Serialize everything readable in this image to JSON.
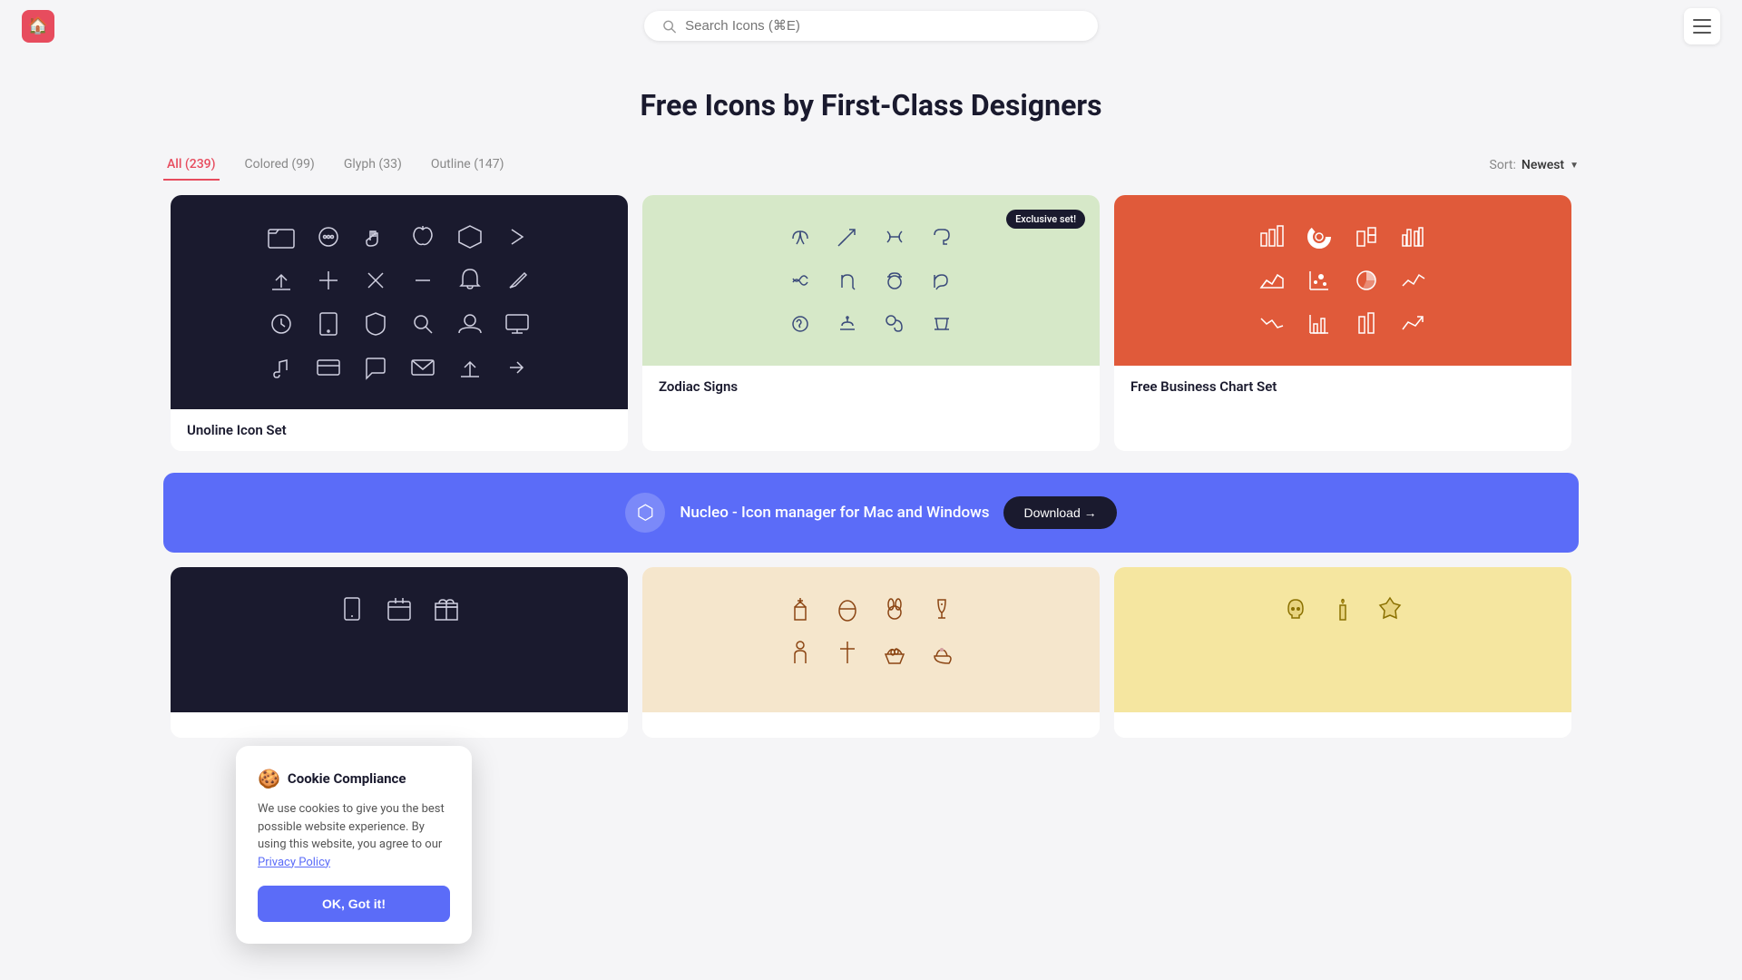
{
  "header": {
    "logo_label": "Nucleo Home",
    "search_placeholder": "Search Icons (⌘E)",
    "menu_label": "Menu"
  },
  "page": {
    "title": "Free Icons by First-Class Designers"
  },
  "filters": {
    "tabs": [
      {
        "id": "all",
        "label": "All (239)",
        "active": true
      },
      {
        "id": "colored",
        "label": "Colored (99)",
        "active": false
      },
      {
        "id": "glyph",
        "label": "Glyph (33)",
        "active": false
      },
      {
        "id": "outline",
        "label": "Outline (147)",
        "active": false
      }
    ],
    "sort_label": "Sort:",
    "sort_value": "Newest"
  },
  "icon_sets": [
    {
      "id": "unoline",
      "label": "Unoline Icon Set",
      "theme": "dark",
      "exclusive": false
    },
    {
      "id": "zodiac",
      "label": "Zodiac Signs",
      "theme": "green",
      "exclusive": true,
      "exclusive_label": "Exclusive set!"
    },
    {
      "id": "business",
      "label": "Free Business Chart Set",
      "theme": "orange",
      "exclusive": false
    }
  ],
  "banner": {
    "text": "Nucleo - Icon manager for Mac and Windows",
    "button_label": "Download →"
  },
  "bottom_sets": [
    {
      "id": "dark-icons",
      "label": "",
      "theme": "dark2"
    },
    {
      "id": "easter",
      "label": "",
      "theme": "peach"
    },
    {
      "id": "skull",
      "label": "",
      "theme": "yellow"
    }
  ],
  "cookie": {
    "emoji": "🍪",
    "title": "Cookie Compliance",
    "body": "We use cookies to give you the best possible website experience. By using this website, you agree to our ",
    "link_text": "Privacy Policy",
    "button_label": "OK, Got it!"
  }
}
